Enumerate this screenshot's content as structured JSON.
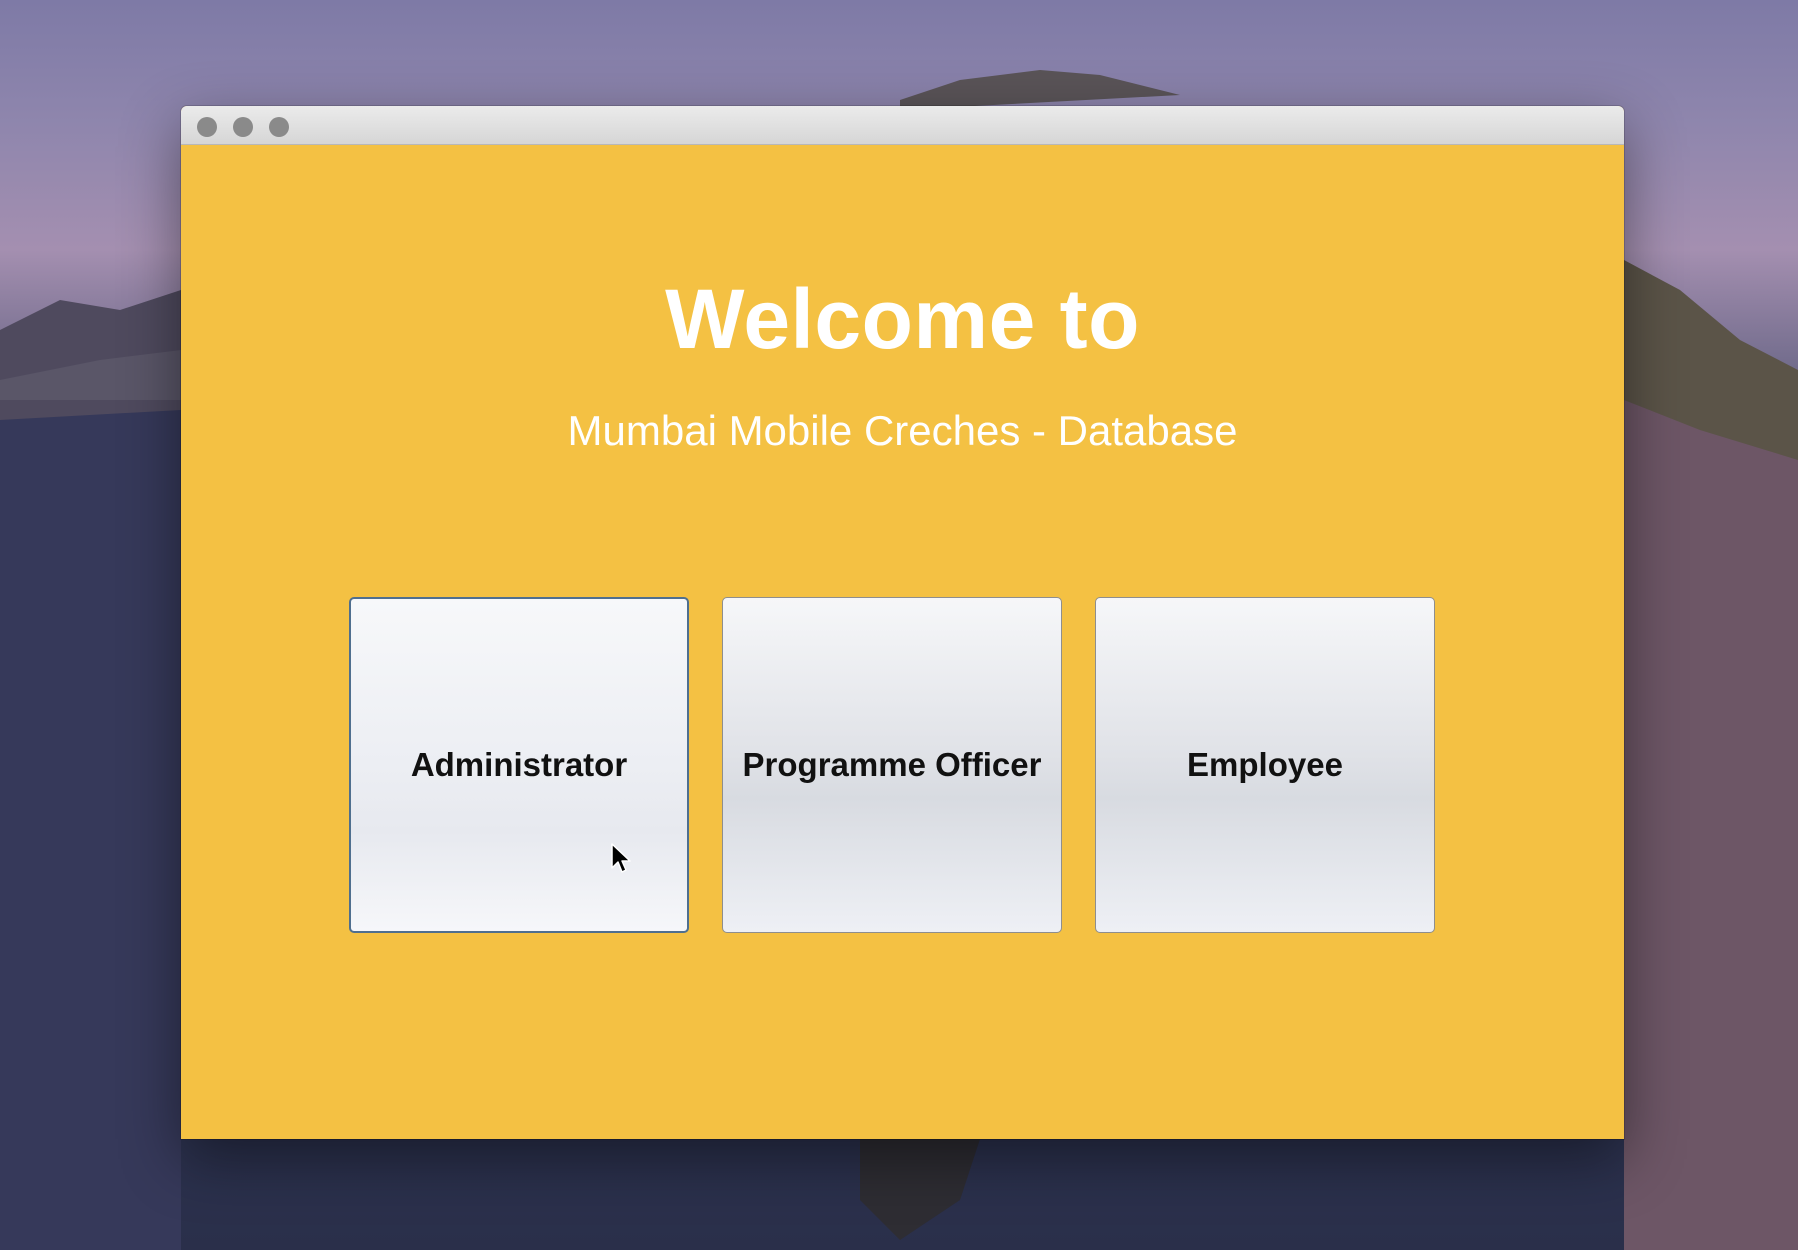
{
  "window": {
    "background_color": "#f4c143"
  },
  "welcome": {
    "title": "Welcome to",
    "subtitle": "Mumbai Mobile Creches - Database"
  },
  "roles": [
    {
      "label": "Administrator"
    },
    {
      "label": "Programme Officer"
    },
    {
      "label": "Employee"
    }
  ]
}
